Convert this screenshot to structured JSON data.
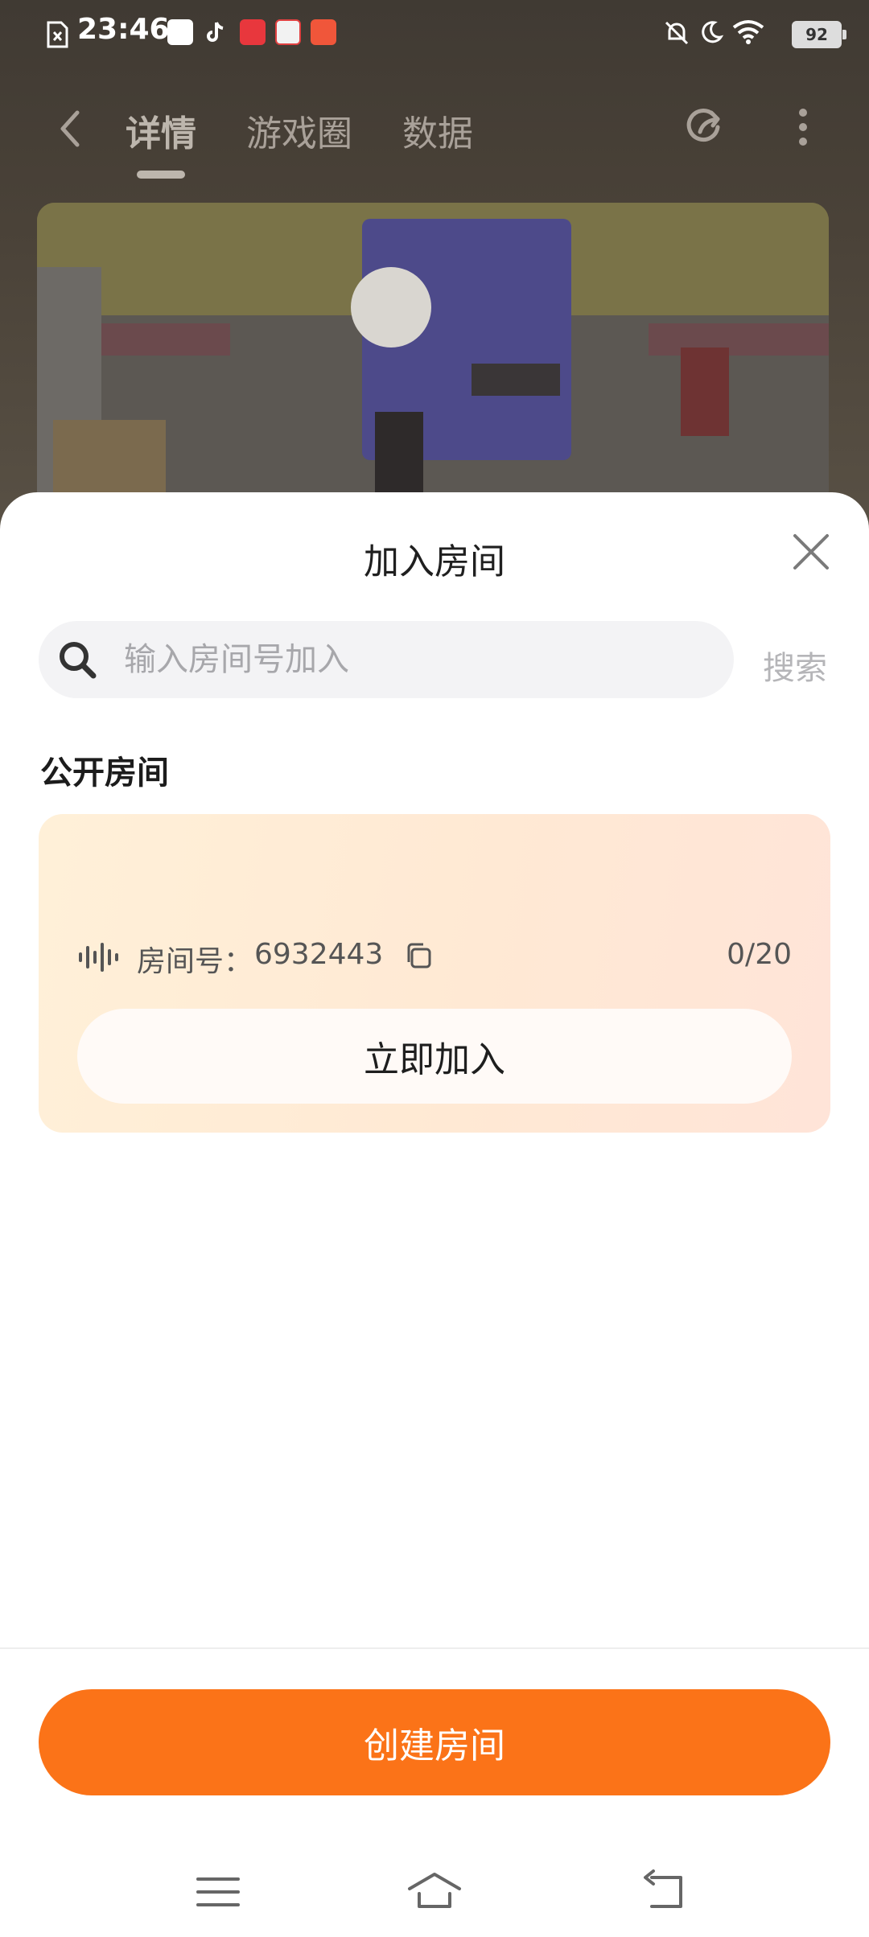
{
  "status_bar": {
    "time": "23:46",
    "battery": "92"
  },
  "nav": {
    "tabs": [
      {
        "label": "详情"
      },
      {
        "label": "游戏圈"
      },
      {
        "label": "数据"
      }
    ]
  },
  "sheet": {
    "title": "加入房间",
    "search": {
      "placeholder": "输入房间号加入",
      "button_label": "搜索"
    },
    "section_title": "公开房间",
    "room": {
      "id_label": "房间号：",
      "id_value": "6932443",
      "count": "0/20",
      "join_label": "立即加入"
    },
    "create_label": "创建房间"
  },
  "colors": {
    "accent": "#fb7318",
    "card_gradient_start": "#fff0d8",
    "card_gradient_end": "#ffe4d8"
  },
  "icons": [
    "back-icon",
    "share-icon",
    "more-icon",
    "close-icon",
    "search-icon",
    "sound-wave-icon",
    "copy-icon",
    "menu-icon",
    "home-icon",
    "return-icon"
  ]
}
